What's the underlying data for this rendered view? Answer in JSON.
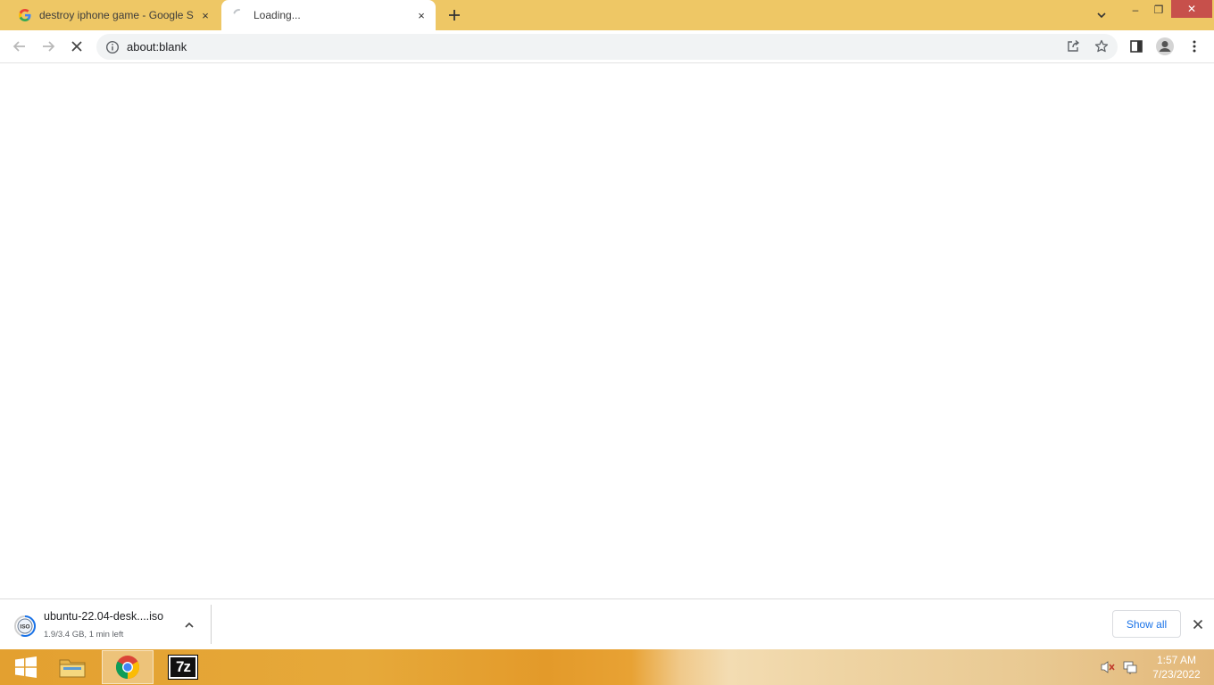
{
  "tabs": [
    {
      "title": "destroy iphone game - Google S",
      "favicon": "google-g-icon",
      "close": "×"
    },
    {
      "title": "Loading...",
      "favicon": "loading-spinner-icon",
      "close": "×"
    }
  ],
  "window_controls": {
    "minimize": "–",
    "restore": "❐",
    "close": "✕"
  },
  "omnibox": {
    "url": "about:blank"
  },
  "download": {
    "filename": "ubuntu-22.04-desk....iso",
    "status": "1.9/3.4 GB, 1 min left",
    "progress": 0.56
  },
  "shelf": {
    "show_all": "Show all"
  },
  "taskbar": {
    "apps": [
      "windows-start-icon",
      "file-explorer-icon",
      "chrome-icon",
      "7zip-icon"
    ],
    "seven_zip_label": "7z"
  },
  "clock": {
    "time": "1:57 AM",
    "date": "7/23/2022"
  },
  "colors": {
    "tabstrip": "#eec765",
    "accent": "#1a73e8",
    "close_button": "#c7504b"
  }
}
